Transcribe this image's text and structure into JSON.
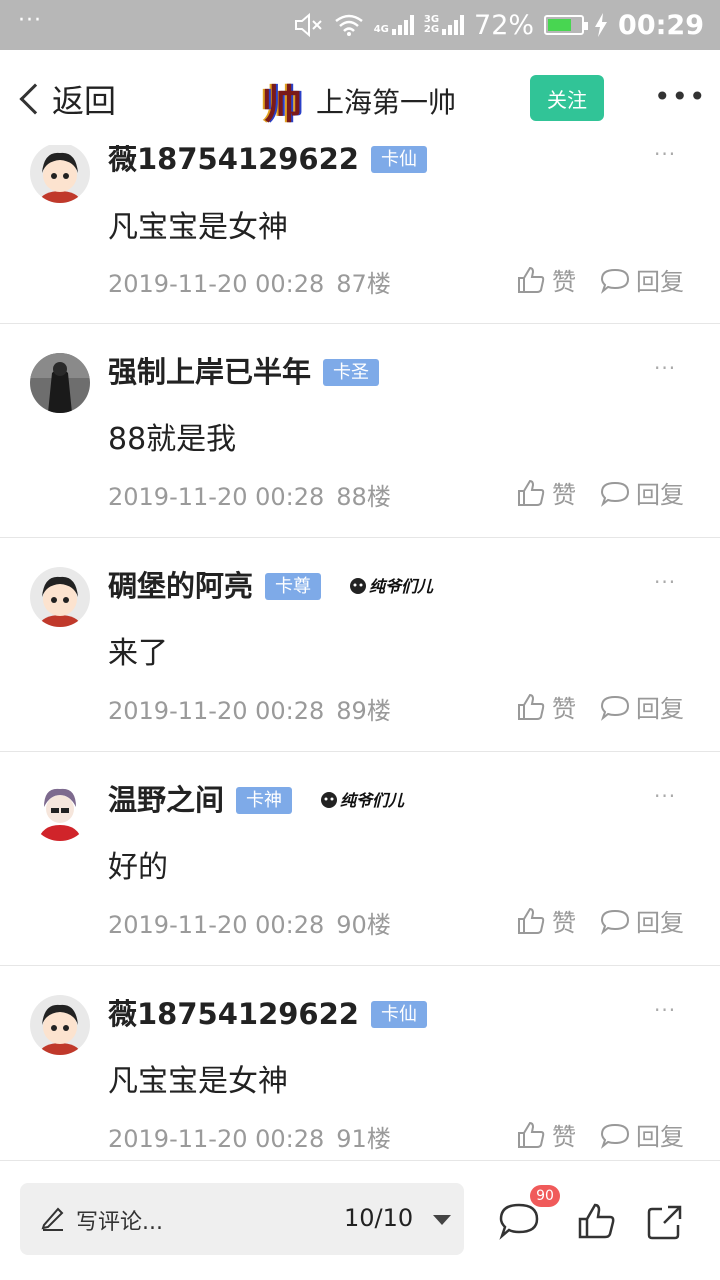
{
  "status_bar": {
    "dots": "···",
    "net_top": "4G",
    "net_3g": "3G",
    "net_2g": "2G",
    "battery_pct": "72%",
    "battery_level": 0.72,
    "time": "00:29",
    "battery_color": "#48d651"
  },
  "nav": {
    "back_label": "返回",
    "logo_glyph": "帅",
    "title": "上海第一帅",
    "follow_label": "关注",
    "more": "•••"
  },
  "posts": [
    {
      "username": "薇18754129622",
      "badge": "卡仙",
      "content": "凡宝宝是女神",
      "time": "2019-11-20 00:28",
      "floor": "87楼",
      "like": "赞",
      "reply": "回复",
      "more": "···"
    },
    {
      "username": "强制上岸已半年",
      "badge": "卡圣",
      "content": "88就是我",
      "time": "2019-11-20 00:28",
      "floor": "88楼",
      "like": "赞",
      "reply": "回复",
      "more": "···"
    },
    {
      "username": "碉堡的阿亮",
      "badge": "卡尊",
      "tag_text": "纯爷们儿",
      "content": "来了",
      "time": "2019-11-20 00:28",
      "floor": "89楼",
      "like": "赞",
      "reply": "回复",
      "more": "···"
    },
    {
      "username": "温野之间",
      "badge": "卡神",
      "tag_text": "纯爷们儿",
      "content": "好的",
      "time": "2019-11-20 00:28",
      "floor": "90楼",
      "like": "赞",
      "reply": "回复",
      "more": "···"
    },
    {
      "username": "薇18754129622",
      "badge": "卡仙",
      "content": "凡宝宝是女神",
      "time": "2019-11-20 00:28",
      "floor": "91楼",
      "like": "赞",
      "reply": "回复",
      "more": "···"
    }
  ],
  "bottom": {
    "comment_placeholder": "写评论...",
    "page_indicator": "10/10",
    "comment_count": "90"
  },
  "colors": {
    "accent_green": "#31c497",
    "badge_blue": "#7eaae8",
    "count_red": "#f05a5a"
  }
}
